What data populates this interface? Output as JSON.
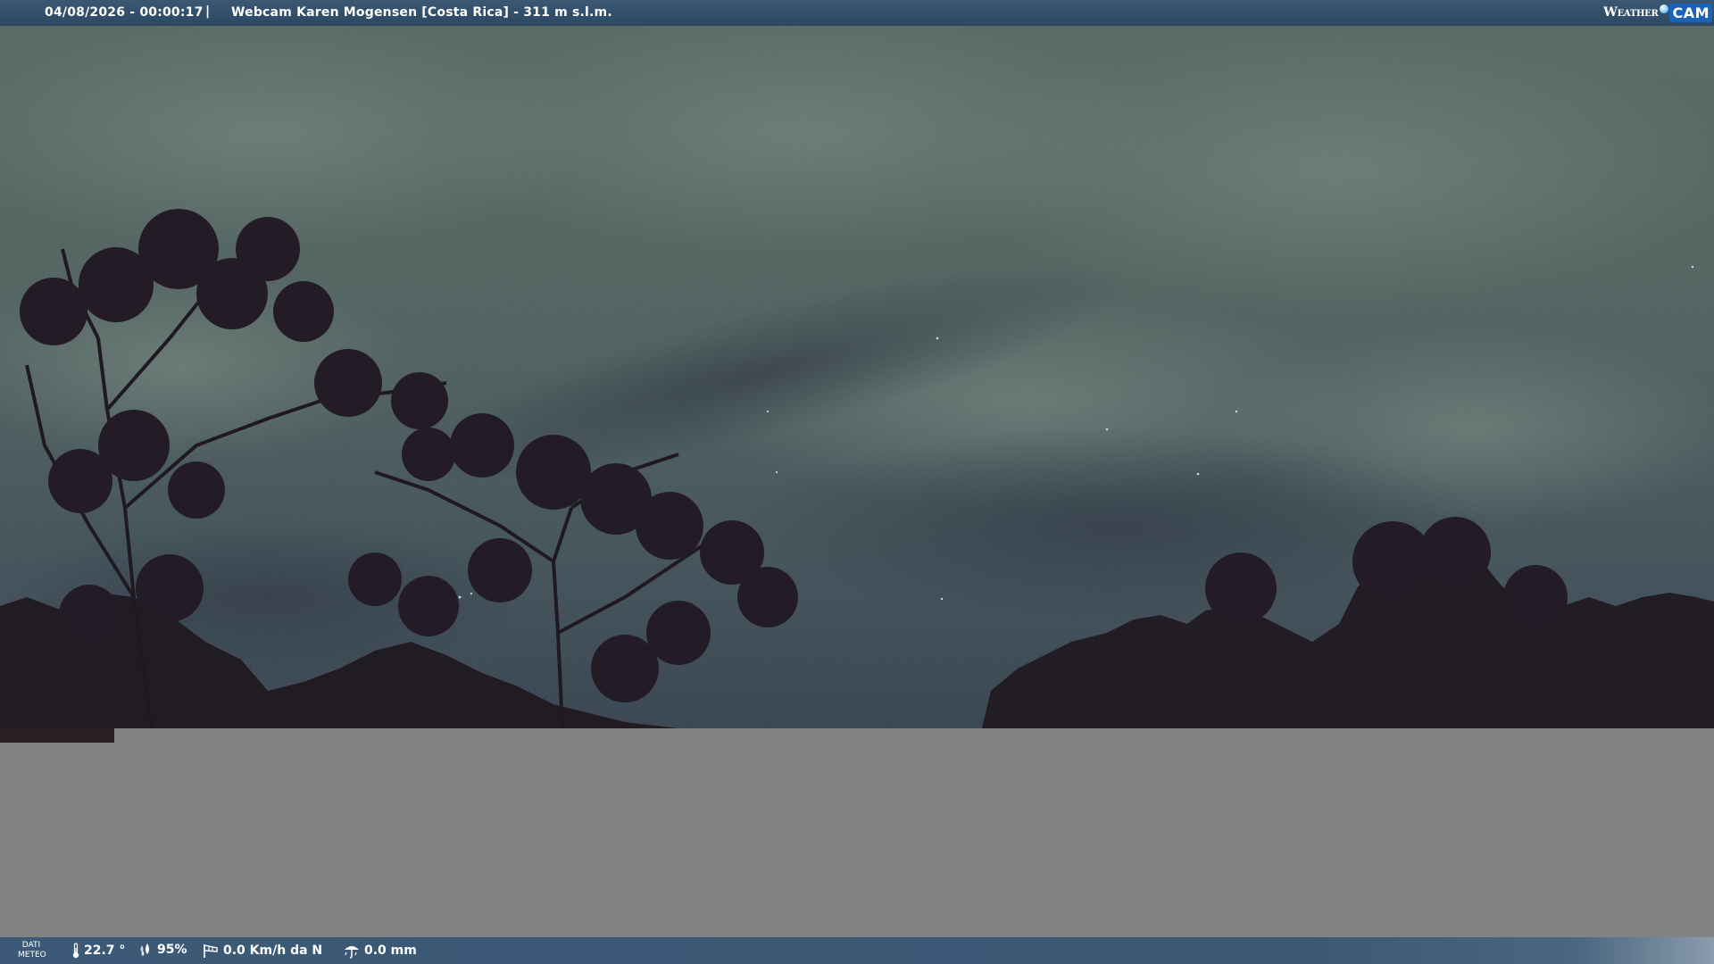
{
  "header": {
    "timestamp": "04/08/2026 - 00:00:17",
    "separator": "|",
    "title": "Webcam Karen Mogensen [Costa Rica]  - 311 m s.l.m.",
    "logo": {
      "word": "Weather",
      "badge": "CAM"
    }
  },
  "footer": {
    "dati_label_1": "DATI",
    "dati_label_2": "METEO",
    "temperature": "22.7 °",
    "humidity": "95%",
    "wind": "0.0 Km/h da N",
    "rain": "0.0 mm",
    "icons": [
      "thermometer-icon",
      "humidity-drops-icon",
      "wind-sock-icon",
      "rain-gauge-icon"
    ]
  },
  "colors": {
    "bar": "#3a5874",
    "gray_panel": "#838383",
    "logo_badge": "#1b63b6",
    "sky_light": "#5a6e6c",
    "sky_dark": "#2f3c4a"
  }
}
